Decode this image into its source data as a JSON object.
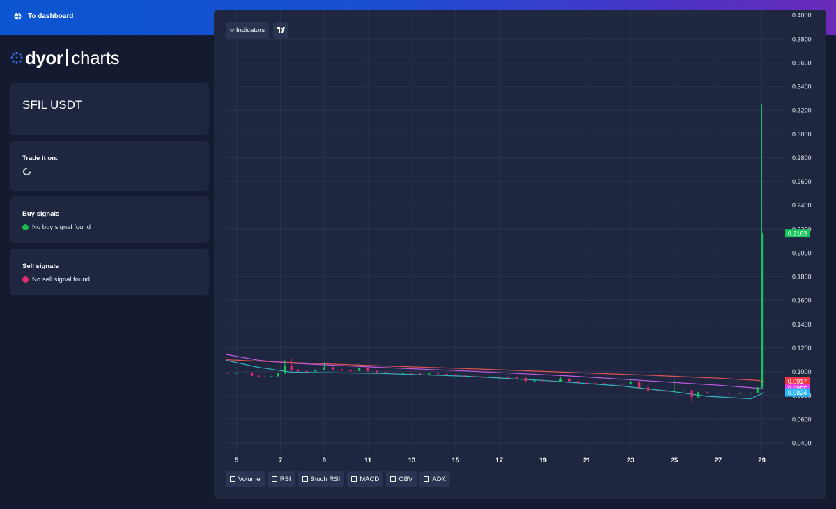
{
  "header": {
    "back_label": "To dashboard",
    "back_icon": "globe-icon"
  },
  "logo": {
    "brand": "dyor",
    "product": "charts"
  },
  "pair": {
    "name": "SFIL USDT"
  },
  "trade": {
    "title": "Trade it on:",
    "loading_icon": "spinner-icon"
  },
  "buy_signals": {
    "title": "Buy signals",
    "status": "No buy signal found",
    "color": "#1bb84a"
  },
  "sell_signals": {
    "title": "Sell signals",
    "status": "No sell signal found",
    "color": "#e0306d"
  },
  "toolbar": {
    "indicators_label": "Indicators",
    "tv_label": "TV"
  },
  "indicator_toggles": [
    "Volume",
    "RSI",
    "Stoch RSI",
    "MACD",
    "OBV",
    "ADX"
  ],
  "colors": {
    "up": "#17c45a",
    "down": "#f0286e",
    "accent": "#0b55d0"
  },
  "chart_data": {
    "type": "candlestick",
    "x_ticks": [
      "5",
      "7",
      "9",
      "11",
      "13",
      "15",
      "17",
      "19",
      "21",
      "23",
      "25",
      "27",
      "29"
    ],
    "y_ticks": [
      "0.4000",
      "0.3800",
      "0.3600",
      "0.3400",
      "0.3200",
      "0.3000",
      "0.2800",
      "0.2600",
      "0.2400",
      "0.2200",
      "0.2000",
      "0.1800",
      "0.1600",
      "0.1400",
      "0.1200",
      "0.1000",
      "0.0800",
      "0.0600",
      "0.0400"
    ],
    "ylim": [
      0.0318,
      0.4045
    ],
    "xlim": [
      4.5,
      30.0
    ],
    "grid": true,
    "price_badges": [
      {
        "value": "0.2163",
        "color": "#17c45a"
      },
      {
        "value": "0.0917",
        "color": "#f23645"
      },
      {
        "value": "0.0855",
        "color": "#e040fb"
      },
      {
        "value": "0.0824",
        "color": "#29b6f6"
      }
    ],
    "moving_averages": [
      {
        "color": "#e0504f",
        "points": [
          [
            4.5,
            0.11
          ],
          [
            7.5,
            0.1076
          ],
          [
            11.5,
            0.1048
          ],
          [
            15.5,
            0.1025
          ],
          [
            20.0,
            0.0995
          ],
          [
            24.0,
            0.0968
          ],
          [
            27.0,
            0.0944
          ],
          [
            28.8,
            0.0925
          ],
          [
            29.1,
            0.0917
          ]
        ]
      },
      {
        "color": "#c15be0",
        "points": [
          [
            4.5,
            0.1145
          ],
          [
            6.0,
            0.1095
          ],
          [
            7.5,
            0.107
          ],
          [
            11.5,
            0.1035
          ],
          [
            15.5,
            0.1005
          ],
          [
            20.0,
            0.0965
          ],
          [
            24.0,
            0.092
          ],
          [
            27.0,
            0.0885
          ],
          [
            28.8,
            0.086
          ],
          [
            29.1,
            0.0855
          ]
        ]
      },
      {
        "color": "#2fb5c0",
        "points": [
          [
            4.5,
            0.1095
          ],
          [
            6.0,
            0.1035
          ],
          [
            7.5,
            0.0995
          ],
          [
            9.5,
            0.099
          ],
          [
            11.5,
            0.0985
          ],
          [
            15.5,
            0.096
          ],
          [
            19.0,
            0.0925
          ],
          [
            22.5,
            0.088
          ],
          [
            25.0,
            0.083
          ],
          [
            26.5,
            0.0792
          ],
          [
            28.5,
            0.0772
          ],
          [
            29.1,
            0.0824
          ]
        ]
      }
    ],
    "candles": [
      [
        4.6,
        0.099,
        0.0992,
        0.0983,
        0.0985
      ],
      [
        5.0,
        0.0985,
        0.0991,
        0.0984,
        0.0989
      ],
      [
        5.4,
        0.0989,
        0.0995,
        0.0986,
        0.0992
      ],
      [
        5.7,
        0.0992,
        0.0994,
        0.096,
        0.0965
      ],
      [
        6.0,
        0.0965,
        0.097,
        0.0955,
        0.0958
      ],
      [
        6.3,
        0.0958,
        0.0962,
        0.095,
        0.0955
      ],
      [
        6.6,
        0.0955,
        0.0965,
        0.0953,
        0.096
      ],
      [
        6.9,
        0.096,
        0.099,
        0.0958,
        0.0985
      ],
      [
        7.2,
        0.0985,
        0.11,
        0.098,
        0.105
      ],
      [
        7.5,
        0.105,
        0.111,
        0.1,
        0.101
      ],
      [
        7.8,
        0.101,
        0.102,
        0.0998,
        0.1005
      ],
      [
        8.2,
        0.1005,
        0.1012,
        0.0998,
        0.1002
      ],
      [
        8.6,
        0.1002,
        0.1018,
        0.1,
        0.1015
      ],
      [
        9.0,
        0.1015,
        0.108,
        0.101,
        0.1035
      ],
      [
        9.4,
        0.1035,
        0.104,
        0.101,
        0.1018
      ],
      [
        9.8,
        0.1018,
        0.1022,
        0.1005,
        0.101
      ],
      [
        10.2,
        0.101,
        0.1015,
        0.1,
        0.1005
      ],
      [
        10.6,
        0.1005,
        0.108,
        0.1,
        0.103
      ],
      [
        11.0,
        0.103,
        0.1035,
        0.1,
        0.1005
      ],
      [
        11.4,
        0.1005,
        0.1008,
        0.099,
        0.0995
      ],
      [
        11.8,
        0.0995,
        0.1,
        0.0985,
        0.099
      ],
      [
        12.2,
        0.099,
        0.0995,
        0.098,
        0.0985
      ],
      [
        12.6,
        0.0985,
        0.0992,
        0.098,
        0.0988
      ],
      [
        13.0,
        0.0988,
        0.0992,
        0.0982,
        0.0985
      ],
      [
        13.4,
        0.0985,
        0.099,
        0.0978,
        0.0982
      ],
      [
        13.8,
        0.0982,
        0.0988,
        0.0978,
        0.0985
      ],
      [
        14.2,
        0.0985,
        0.099,
        0.0978,
        0.098
      ],
      [
        14.6,
        0.098,
        0.0985,
        0.097,
        0.0975
      ],
      [
        15.0,
        0.0975,
        0.098,
        0.0962,
        0.0965
      ],
      [
        15.4,
        0.0965,
        0.097,
        0.0955,
        0.096
      ],
      [
        15.8,
        0.096,
        0.0965,
        0.0952,
        0.0958
      ],
      [
        16.2,
        0.0958,
        0.0962,
        0.095,
        0.0955
      ],
      [
        16.6,
        0.0955,
        0.096,
        0.095,
        0.0957
      ],
      [
        17.0,
        0.0957,
        0.096,
        0.0948,
        0.0952
      ],
      [
        17.4,
        0.0952,
        0.0956,
        0.0945,
        0.095
      ],
      [
        17.8,
        0.095,
        0.0955,
        0.094,
        0.0945
      ],
      [
        18.2,
        0.0945,
        0.095,
        0.0915,
        0.092
      ],
      [
        18.6,
        0.092,
        0.0928,
        0.0912,
        0.0925
      ],
      [
        19.0,
        0.0925,
        0.093,
        0.0915,
        0.092
      ],
      [
        19.4,
        0.092,
        0.0925,
        0.091,
        0.0918
      ],
      [
        19.8,
        0.0918,
        0.0955,
        0.0915,
        0.0935
      ],
      [
        20.2,
        0.0935,
        0.094,
        0.0915,
        0.092
      ],
      [
        20.6,
        0.092,
        0.0925,
        0.0902,
        0.0905
      ],
      [
        21.0,
        0.0905,
        0.091,
        0.0898,
        0.0902
      ],
      [
        21.4,
        0.0902,
        0.0907,
        0.0896,
        0.09
      ],
      [
        21.8,
        0.09,
        0.0905,
        0.0895,
        0.0898
      ],
      [
        22.2,
        0.0898,
        0.0902,
        0.0892,
        0.0896
      ],
      [
        22.6,
        0.0896,
        0.09,
        0.089,
        0.0894
      ],
      [
        23.0,
        0.0894,
        0.093,
        0.089,
        0.0915
      ],
      [
        23.4,
        0.0915,
        0.0918,
        0.086,
        0.0865
      ],
      [
        23.8,
        0.0865,
        0.087,
        0.0835,
        0.084
      ],
      [
        24.2,
        0.084,
        0.0845,
        0.0835,
        0.0838
      ],
      [
        24.6,
        0.0838,
        0.0842,
        0.0832,
        0.0836
      ],
      [
        25.0,
        0.0836,
        0.093,
        0.083,
        0.084
      ],
      [
        25.4,
        0.084,
        0.0845,
        0.0835,
        0.0842
      ],
      [
        25.8,
        0.0842,
        0.0845,
        0.074,
        0.0785
      ],
      [
        26.1,
        0.0785,
        0.083,
        0.0775,
        0.0825
      ],
      [
        26.5,
        0.0825,
        0.083,
        0.0818,
        0.0822
      ],
      [
        27.0,
        0.0822,
        0.0826,
        0.0818,
        0.082
      ],
      [
        27.5,
        0.082,
        0.0824,
        0.0816,
        0.0819
      ],
      [
        28.0,
        0.0819,
        0.0823,
        0.0816,
        0.082
      ],
      [
        28.5,
        0.082,
        0.0824,
        0.0817,
        0.0822
      ],
      [
        28.8,
        0.0822,
        0.087,
        0.0818,
        0.0865
      ],
      [
        29.0,
        0.0865,
        0.325,
        0.086,
        0.2163
      ]
    ]
  }
}
